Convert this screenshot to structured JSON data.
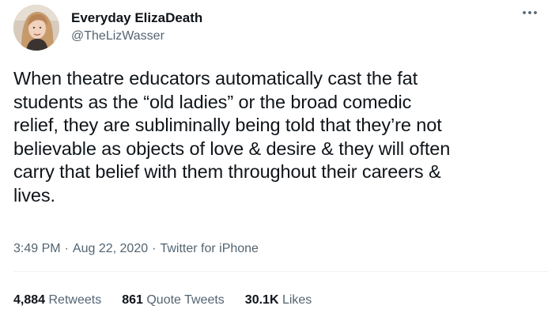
{
  "author": {
    "display_name": "Everyday ElizaDeath",
    "handle": "@TheLizWasser",
    "avatar_icon": "user-avatar-photo"
  },
  "tweet": {
    "text": "When theatre educators automatically cast the fat\nstudents as the “old ladies” or the broad comedic\nrelief, they are subliminally being told that they’re not\nbelievable as objects of love & desire & they will often\ncarry that belief with them throughout their careers &\nlives.",
    "time": "3:49 PM",
    "date": "Aug 22, 2020",
    "source": "Twitter for iPhone",
    "separator": "·"
  },
  "stats": {
    "retweets_count": "4,884",
    "retweets_label": "Retweets",
    "quotes_count": "861",
    "quotes_label": "Quote Tweets",
    "likes_count": "30.1K",
    "likes_label": "Likes"
  },
  "menu": {
    "icon": "more-icon"
  },
  "colors": {
    "text_primary": "#0f1419",
    "text_secondary": "#536471",
    "divider": "#eff3f4",
    "background": "#ffffff"
  }
}
